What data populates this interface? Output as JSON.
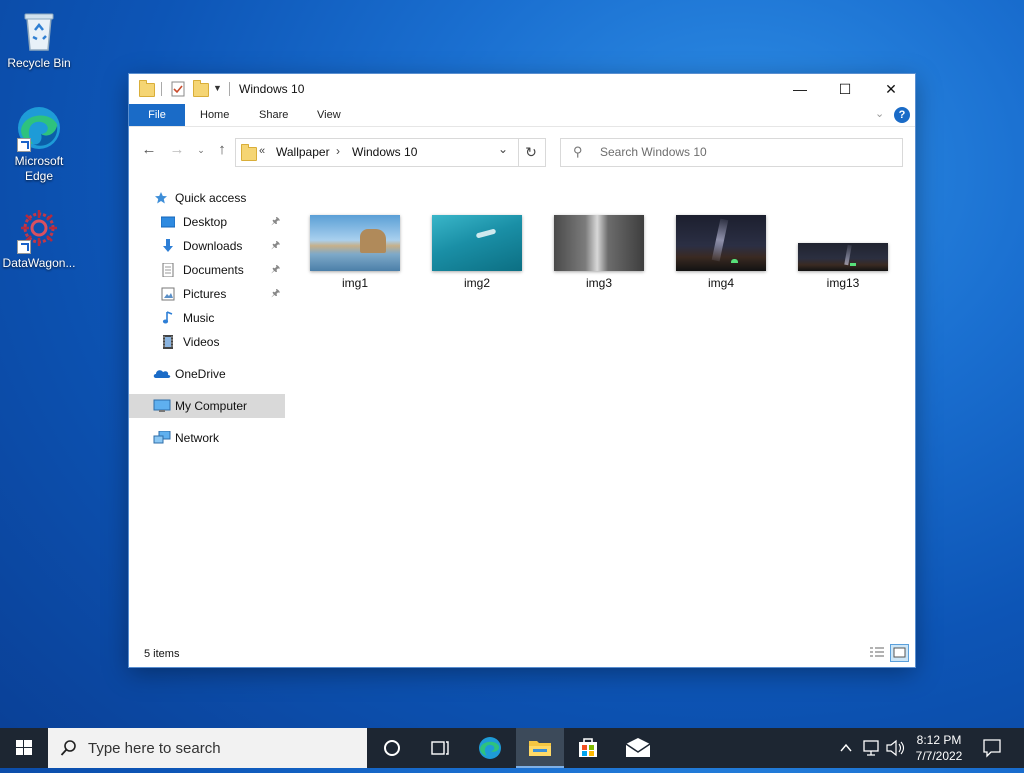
{
  "desktop": {
    "icons": [
      {
        "label": "Recycle Bin",
        "icon": "recycle-bin-icon"
      },
      {
        "label": "Microsoft Edge",
        "line1": "Microsoft",
        "line2": "Edge",
        "icon": "edge-icon"
      },
      {
        "label": "DataWagon...",
        "icon": "datawagon-icon"
      }
    ]
  },
  "window": {
    "title": "Windows 10",
    "controls": {
      "minimize": "—",
      "maximize": "☐",
      "close": "✕"
    },
    "ribbon": {
      "tabs": [
        "File",
        "Home",
        "Share",
        "View"
      ]
    },
    "address": {
      "overflow": "«",
      "crumbs": [
        "Wallpaper",
        "Windows 10"
      ],
      "separator": "›"
    },
    "search": {
      "placeholder": "Search Windows 10"
    },
    "nav_pane": {
      "quick_access": "Quick access",
      "pinned": [
        {
          "label": "Desktop",
          "icon": "desktop-icon"
        },
        {
          "label": "Downloads",
          "icon": "downloads-icon"
        },
        {
          "label": "Documents",
          "icon": "documents-icon"
        },
        {
          "label": "Pictures",
          "icon": "pictures-icon"
        },
        {
          "label": "Music",
          "icon": "music-icon"
        },
        {
          "label": "Videos",
          "icon": "videos-icon"
        }
      ],
      "onedrive": "OneDrive",
      "my_computer": "My Computer",
      "network": "Network"
    },
    "files": [
      {
        "name": "img1",
        "thumb": "beach-rocks-reflection"
      },
      {
        "name": "img2",
        "thumb": "underwater-diver"
      },
      {
        "name": "img3",
        "thumb": "waterfall-cliff"
      },
      {
        "name": "img4",
        "thumb": "night-sky-tent"
      },
      {
        "name": "img13",
        "thumb": "night-sky-tent-wide"
      }
    ],
    "status": {
      "item_count": "5 items"
    }
  },
  "taskbar": {
    "search_placeholder": "Type here to search",
    "clock": {
      "time": "8:12 PM",
      "date": "7/7/2022"
    },
    "apps": [
      "cortana-icon",
      "task-view-icon",
      "edge-icon",
      "file-explorer-icon",
      "store-icon",
      "mail-icon"
    ]
  },
  "colors": {
    "accent": "#1a6bc7",
    "taskbar": "#1d2632",
    "selection": "#d9d9d9"
  }
}
